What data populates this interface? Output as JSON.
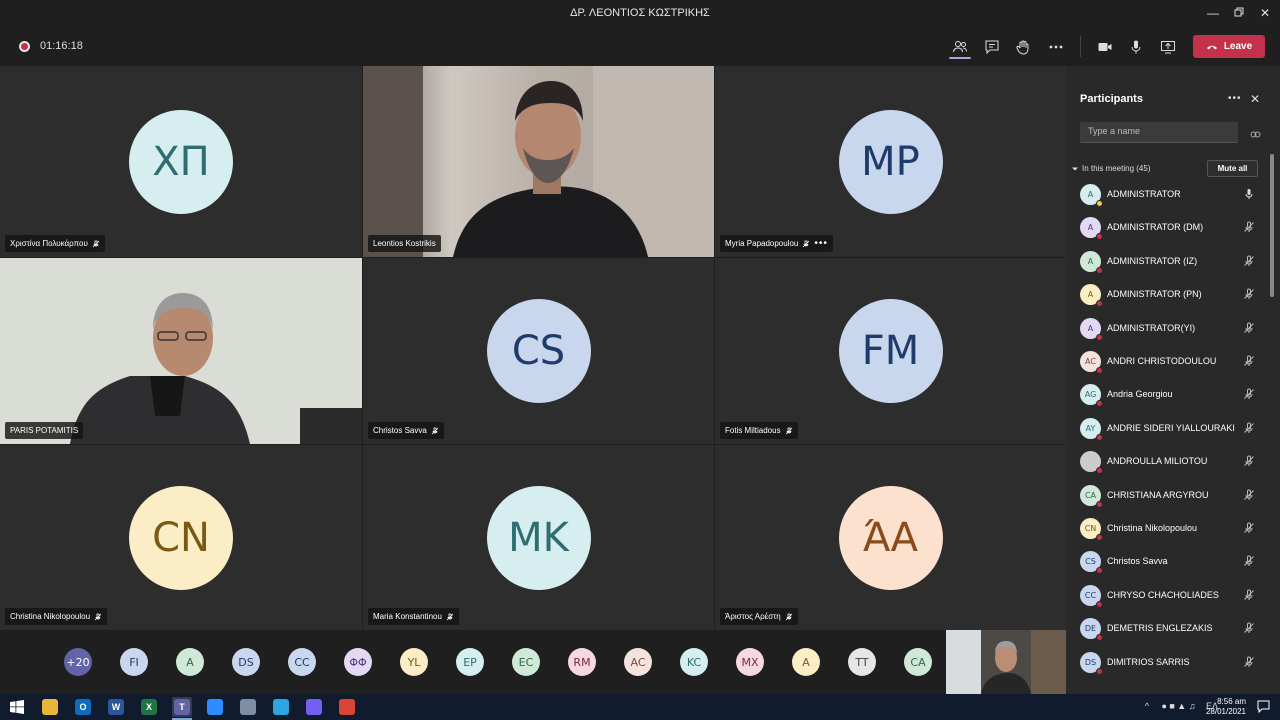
{
  "window": {
    "title": "ΔΡ. ΛΕΟΝΤΙΟΣ ΚΩΣΤΡΙΚΗΣ"
  },
  "toolbar": {
    "timer": "01:16:18",
    "leave_label": "Leave"
  },
  "tiles": [
    {
      "name": "Χριστίνα Πολυκάρπου",
      "initials": "ΧΠ",
      "bg": "#d7eef0",
      "fg": "#2e6d72",
      "muted": true
    },
    {
      "name": "Leontios Kostrikis",
      "initials": "",
      "video": true
    },
    {
      "name": "Myria Papadopoulou",
      "initials": "MP",
      "bg": "#c9d7ee",
      "fg": "#1f3b6b",
      "muted": true
    },
    {
      "name": "PARIS POTAMITIS",
      "initials": "",
      "video": true
    },
    {
      "name": "Christos Savva",
      "initials": "CS",
      "bg": "#c9d7ee",
      "fg": "#1f3b6b",
      "muted": true
    },
    {
      "name": "Fotis Miltiadous",
      "initials": "FM",
      "bg": "#c9d7ee",
      "fg": "#1f3b6b",
      "muted": true
    },
    {
      "name": "Christina Nikolopoulou",
      "initials": "CN",
      "bg": "#fbeec6",
      "fg": "#7a5a12",
      "muted": true
    },
    {
      "name": "Maria Konstantinou",
      "initials": "MK",
      "bg": "#d7eef0",
      "fg": "#2e6d72",
      "muted": true
    },
    {
      "name": "Άριστος Αρέστη",
      "initials": "ΆΑ",
      "bg": "#fde1cf",
      "fg": "#8a4a1c",
      "muted": true
    }
  ],
  "overflow": [
    {
      "label": "+20",
      "bg": "#6264a7",
      "fg": "#ffffff"
    },
    {
      "label": "FI",
      "bg": "#c9d7ee",
      "fg": "#1f3b6b"
    },
    {
      "label": "A",
      "bg": "#cfe8d8",
      "fg": "#2d6a45"
    },
    {
      "label": "DS",
      "bg": "#c9d7ee",
      "fg": "#1f3b6b"
    },
    {
      "label": "CC",
      "bg": "#c9d7ee",
      "fg": "#1f3b6b"
    },
    {
      "label": "ΦΦ",
      "bg": "#e3d9f2",
      "fg": "#4e3a7a"
    },
    {
      "label": "YL",
      "bg": "#fbeec6",
      "fg": "#7a5a12"
    },
    {
      "label": "EP",
      "bg": "#d7eef0",
      "fg": "#2e6d72"
    },
    {
      "label": "EC",
      "bg": "#cfe8d8",
      "fg": "#2d6a45"
    },
    {
      "label": "RM",
      "bg": "#f6d9e0",
      "fg": "#7a2a3d"
    },
    {
      "label": "AC",
      "bg": "#f3e3dc",
      "fg": "#7a4a35"
    },
    {
      "label": "KC",
      "bg": "#d7eef0",
      "fg": "#2e6d72"
    },
    {
      "label": "MX",
      "bg": "#f6d9e0",
      "fg": "#7a2a3d"
    },
    {
      "label": "A",
      "bg": "#fbeec6",
      "fg": "#7a5a12"
    },
    {
      "label": "TT",
      "bg": "#e6e6e6",
      "fg": "#444444"
    },
    {
      "label": "CA",
      "bg": "#cfe8d8",
      "fg": "#2d6a45"
    }
  ],
  "panel": {
    "title": "Participants",
    "search_placeholder": "Type a name",
    "in_meeting": "In this meeting (45)",
    "mute_all": "Mute all",
    "participants": [
      {
        "name": "ADMINISTRATOR",
        "initials": "A",
        "bg": "#d7eef0",
        "fg": "#2e6d72",
        "status": "#f8c544",
        "mic": "on"
      },
      {
        "name": "ADMINISTRATOR (DM)",
        "initials": "A",
        "bg": "#e3d9f2",
        "fg": "#4e3a7a",
        "status": "#c4314b",
        "mic": "off"
      },
      {
        "name": "ADMINISTRATOR (IZ)",
        "initials": "A",
        "bg": "#cfe8d8",
        "fg": "#2d6a45",
        "status": "#c4314b",
        "mic": "off"
      },
      {
        "name": "ADMINISTRATOR (PN)",
        "initials": "A",
        "bg": "#fbeec6",
        "fg": "#7a5a12",
        "status": "#c4314b",
        "mic": "off"
      },
      {
        "name": "ADMINISTRATOR(YI)",
        "initials": "A",
        "bg": "#e3d9f2",
        "fg": "#4e3a7a",
        "status": "#c4314b",
        "mic": "off"
      },
      {
        "name": "ANDRI CHRISTODOULOU",
        "initials": "AC",
        "bg": "#f3e3dc",
        "fg": "#7a4a35",
        "status": "#c4314b",
        "mic": "off"
      },
      {
        "name": "Andria Georgiou",
        "initials": "AG",
        "bg": "#d7eef0",
        "fg": "#2e6d72",
        "status": "#c4314b",
        "mic": "off"
      },
      {
        "name": "ANDRIE SIDERI YIALLOURAKI",
        "initials": "AY",
        "bg": "#d7eef0",
        "fg": "#2e6d72",
        "status": "#c4314b",
        "mic": "off"
      },
      {
        "name": "ANDROULLA MILIOTOU",
        "initials": "",
        "bg": "#cccccc",
        "fg": "#333333",
        "status": "#c4314b",
        "mic": "off"
      },
      {
        "name": "CHRISTIANA ARGYROU",
        "initials": "CA",
        "bg": "#cfe8d8",
        "fg": "#2d6a45",
        "status": "#c4314b",
        "mic": "off"
      },
      {
        "name": "Christina Nikolopoulou",
        "initials": "CN",
        "bg": "#fbeec6",
        "fg": "#7a5a12",
        "status": "#c4314b",
        "mic": "off"
      },
      {
        "name": "Christos Savva",
        "initials": "CS",
        "bg": "#c9d7ee",
        "fg": "#1f3b6b",
        "status": "#c4314b",
        "mic": "off"
      },
      {
        "name": "CHRYSO CHACHOLIADES",
        "initials": "CC",
        "bg": "#c9d7ee",
        "fg": "#1f3b6b",
        "status": "#c4314b",
        "mic": "off"
      },
      {
        "name": "DEMETRIS ENGLEZAKIS",
        "initials": "DE",
        "bg": "#c9d7ee",
        "fg": "#1f3b6b",
        "status": "#c4314b",
        "mic": "off"
      },
      {
        "name": "DIMITRIOS SARRIS",
        "initials": "DS",
        "bg": "#c9d7ee",
        "fg": "#1f3b6b",
        "status": "#c4314b",
        "mic": "off"
      }
    ]
  },
  "taskbar": {
    "lang": "ΕΛ",
    "time": "8:56 am",
    "date": "28/01/2021",
    "apps": [
      {
        "name": "file-explorer-icon",
        "label": "",
        "bg": "#e8b73a"
      },
      {
        "name": "outlook-icon",
        "label": "O",
        "bg": "#0f6cbd"
      },
      {
        "name": "word-icon",
        "label": "W",
        "bg": "#2b579a"
      },
      {
        "name": "excel-icon",
        "label": "X",
        "bg": "#217346"
      },
      {
        "name": "teams-icon",
        "label": "T",
        "bg": "#6264a7"
      },
      {
        "name": "zoom-icon",
        "label": "",
        "bg": "#2d8cff"
      },
      {
        "name": "paint-icon",
        "label": "",
        "bg": "#7f8ea3"
      },
      {
        "name": "telegram-icon",
        "label": "",
        "bg": "#2ca5e0"
      },
      {
        "name": "viber-icon",
        "label": "",
        "bg": "#7360f2"
      },
      {
        "name": "chrome-icon",
        "label": "",
        "bg": "#db4437"
      }
    ]
  }
}
